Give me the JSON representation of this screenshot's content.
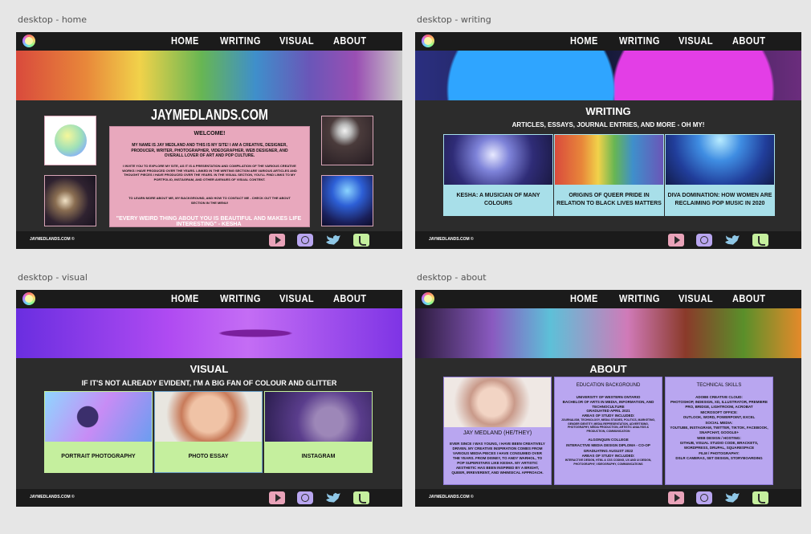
{
  "frame_labels": {
    "home": "desktop - home",
    "writing": "desktop - writing",
    "visual": "desktop - visual",
    "about": "desktop - about"
  },
  "nav": {
    "home": "HOME",
    "writing": "WRITING",
    "visual": "VISUAL",
    "about": "ABOUT"
  },
  "footer_copy": "JAYMEDLANDS.COM ©",
  "home": {
    "site_title": "JAYMEDLANDS.COM",
    "welcome_heading": "WELCOME!",
    "welcome_p1": "MY NAME IS JAY MEDLAND AND THIS IS MY SITE! I AM A CREATIVE, DESIGNER, PRODUCER, WRITER, PHOTOGRAPHER, VIDEOGRAPHER, WEB DESIGNER, AND OVERALL LOVER OF ART AND POP CULTURE.",
    "welcome_p2": "I INVITE YOU TO EXPLORE MY SITE, AS IT IS A PRESENTATION AND COMPILATION OF THE VARIOUS CREATIVE WORKS I HAVE PRODUCED OVER THE YEARS. LINKED IN THE WRITING SECTION ARE VARIOUS ARTICLES AND THOUGHT PIECES I HAVE PRODUCED OVER THE YEARS. IN THE VISUAL SECTION, YOU'LL FIND LINKS TO MY PORTFOLIO, INSTAGRAM, AND OTHER AVENUES OF VISUAL CONTENT.",
    "welcome_p3": "TO LEARN MORE ABOUT ME, MY BACKGROUND, AND HOW TO CONTACT ME - CHECK OUT THE ABOUT SECTION IN THE MENU!",
    "quote": "\"EVERY WEIRD THING ABOUT YOU IS BEAUTIFUL AND MAKES LIFE INTERESTING\" - KESHA"
  },
  "writing": {
    "heading": "WRITING",
    "subheading": "ARTICLES, ESSAYS, JOURNAL ENTRIES, AND MORE - OH MY!",
    "cards": [
      {
        "caption": "KESHA: A MUSICIAN OF MANY COLOURS"
      },
      {
        "caption": "ORIGINS OF QUEER PRIDE IN RELATION TO BLACK LIVES MATTERS"
      },
      {
        "caption": "DIVA DOMINATION: HOW WOMEN ARE RECLAIMING POP MUSIC IN 2020"
      }
    ]
  },
  "visual": {
    "heading": "VISUAL",
    "subheading": "IF IT'S NOT ALREADY EVIDENT, I'M A BIG FAN OF COLOUR AND GLITTER",
    "cards": [
      {
        "caption": "PORTRAIT PHOTOGRAPHY"
      },
      {
        "caption": "PHOTO ESSAY"
      },
      {
        "caption": "INSTAGRAM"
      }
    ]
  },
  "about": {
    "heading": "ABOUT",
    "name": "JAY MEDLAND (HE/THEY)",
    "bio": "EVER SINCE I WAS YOUNG, I HAVE BEEN CREATIVELY DRIVEN. MY CREATIVE INSPIRATION COMES FROM VARIOUS MEDIA PIECES I HAVE CONSUMED OVER THE YEARS. FROM DISNEY, TO ANDY WARHOL, TO POP SUPERSTARS LIKE KESHA. MY ARTISTIC AESTHETIC HAS BEEN INSPIRED BY A BRIGHT, QUEER, IRREVERENT, AND WHIMSICAL APPROACH.",
    "edu_heading": "EDUCATION BACKGROUND",
    "edu_1": "UNIVERSITY OF WESTERN ONTARIO",
    "edu_2": "BACHELOR OF ARTS IN MEDIA, INFORMATION, AND TECHNOCULTURE",
    "edu_3": "GRADUATED APRIL 2021",
    "edu_4": "AREAS OF STUDY INCLUDED:",
    "edu_5": "JOURNALISM, TECHNOLOGY, MEDIA STUDIES, POLITICS, MARKETING, GENDER IDENTITY, MEDIA REPRESENTATION, ADVERTISING, PHOTOGRAPHY, MEDIA PRODUCTION, ARTISTIC ANALYSIS & PRODUCTION, COMMUNICATION",
    "edu_6": "ALGONQUIN COLLEGE",
    "edu_7": "INTERACTIVE MEDIA DESIGN DIPLOMA - CO-OP",
    "edu_8": "GRADUATING AUGUST 2022",
    "edu_9": "AREAS OF STUDY INCLUDED:",
    "edu_10": "INTERACTIVE DESIGN, HTML & CSS CODING, UX AND UI DESIGN, PHOTOGRAPHY, VIDEOGRAPHY, COMMUNICATIONS",
    "tech_heading": "TECHNICAL SKILLS",
    "tech_1": "ADOBE CREATIVE CLOUD:",
    "tech_2": "PHOTOSHOP, INDESIGN, XD, ILLUSTRATOR, PREMIERE PRO, BRIDGE, LIGHTROOM, ACROBAT",
    "tech_3": "MICROSOFT OFFICE:",
    "tech_4": "OUTLOOK, WORD, POWERPOINT, EXCEL",
    "tech_5": "SOCIAL MEDIA:",
    "tech_6": "YOUTUBE, INSTAGRAM, TWITTER, TIKTOK, FACEBOOK, SNAPCHAT, GOOGLE+",
    "tech_7": "WEB DESIGN / HOSTING:",
    "tech_8": "GITHUB, VISUAL STUDIO CODE, BRACKETS, WORDPRESS, DRUPAL, SQUARESPACE",
    "tech_9": "FILM / PHOTOGRAPHY:",
    "tech_10": "DSLR CAMERAS, SET DESIGN, STORYBOARDING"
  }
}
